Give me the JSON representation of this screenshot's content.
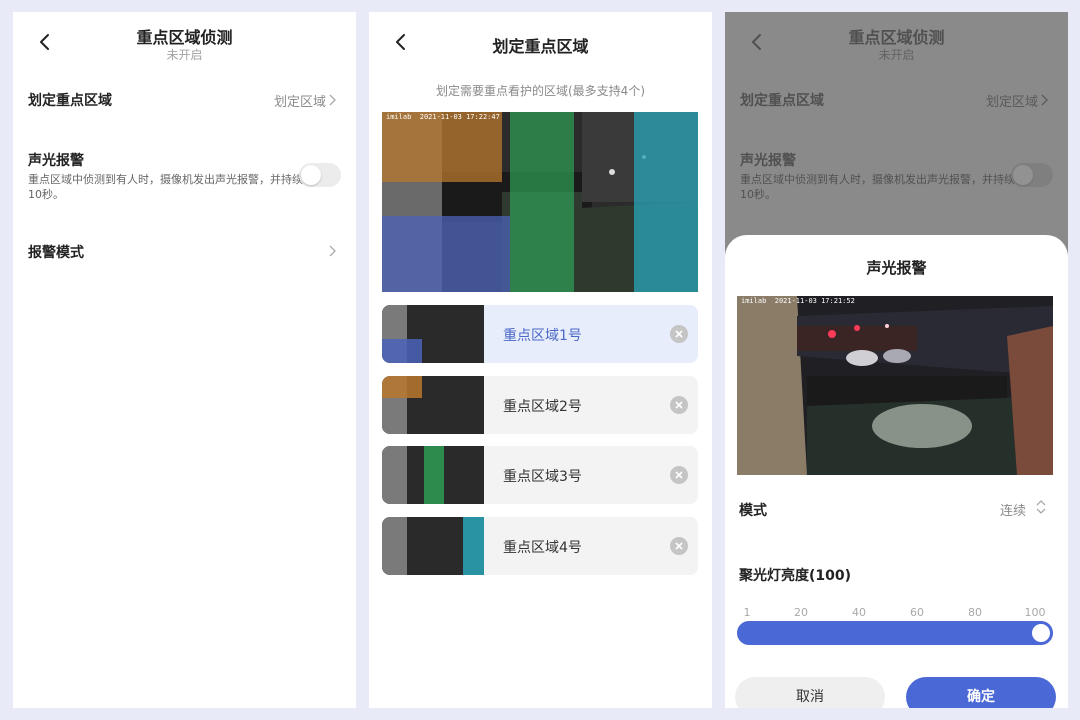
{
  "screen1": {
    "title": "重点区域侦测",
    "subtitle": "未开启",
    "zone_row": {
      "label": "划定重点区域",
      "value": "划定区域"
    },
    "alarm_row": {
      "label": "声光报警",
      "desc": "重点区域中侦测到有人时，摄像机发出声光报警，并持续10秒。"
    },
    "mode_row": {
      "label": "报警模式"
    }
  },
  "screen2": {
    "title": "划定重点区域",
    "hint": "划定需要重点看护的区域(最多支持4个)",
    "timestamp": "2021-11-03  17:22:47",
    "brand": "imilab",
    "zones": [
      {
        "label": "重点区域1号",
        "color": "#4b63b8"
      },
      {
        "label": "重点区域2号",
        "color": "#b8782e"
      },
      {
        "label": "重点区域3号",
        "color": "#2e9c55"
      },
      {
        "label": "重点区域4号",
        "color": "#2aa6b8"
      }
    ]
  },
  "screen3": {
    "title": "重点区域侦测",
    "subtitle": "未开启",
    "zone_row": {
      "label": "划定重点区域",
      "value": "划定区域"
    },
    "alarm_row": {
      "label": "声光报警",
      "desc": "重点区域中侦测到有人时，摄像机发出声光报警，并持续10秒。"
    },
    "sheet": {
      "title": "声光报警",
      "brand": "imilab",
      "timestamp": "2021-11-03  17:21:52",
      "mode_label": "模式",
      "mode_value": "连续",
      "brightness_label": "聚光灯亮度(100)",
      "ticks": [
        "1",
        "20",
        "40",
        "60",
        "80",
        "100"
      ],
      "brightness_value": 100,
      "cancel": "取消",
      "confirm": "确定"
    }
  },
  "colors": {
    "accent": "#4a68d6",
    "zone_text_active": "#4a68c8"
  },
  "icons": [
    "back-arrow-icon",
    "chevron-right-icon",
    "close-circle-icon",
    "up-down-caret-icon"
  ]
}
